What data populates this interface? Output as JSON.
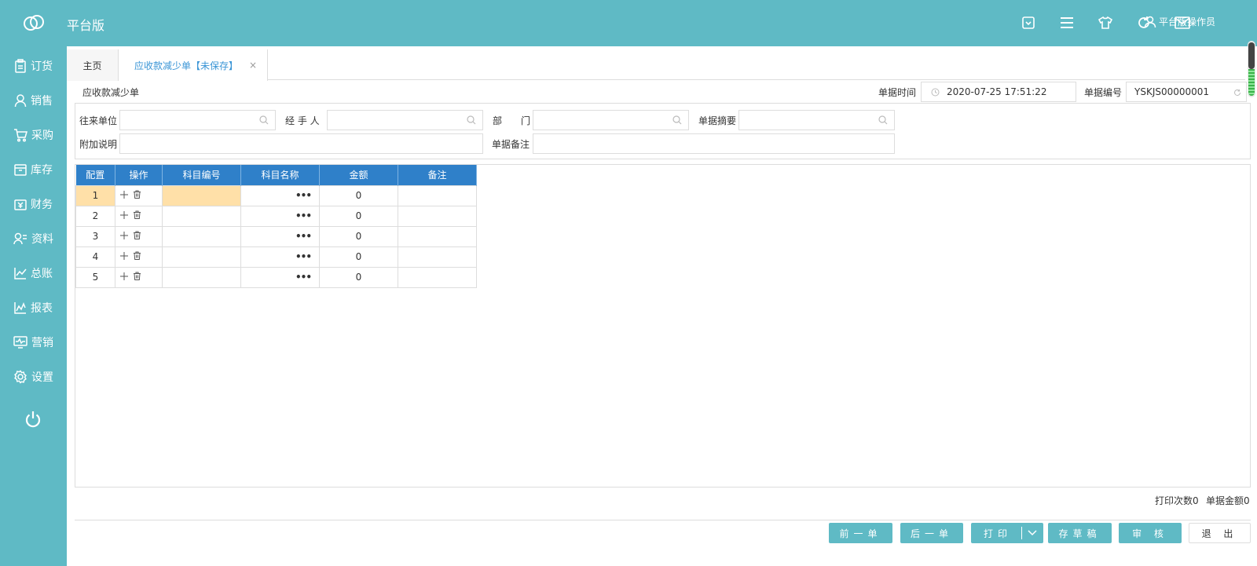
{
  "app": {
    "title": "平台版",
    "user": "平台版操作员"
  },
  "top_icons": [
    "inbox-icon",
    "menu-icon",
    "shirt-icon",
    "refresh-icon",
    "mail-icon"
  ],
  "sidebar": {
    "items": [
      {
        "label": "订货",
        "icon": "clipboard-icon"
      },
      {
        "label": "销售",
        "icon": "user-icon"
      },
      {
        "label": "采购",
        "icon": "cart-icon"
      },
      {
        "label": "库存",
        "icon": "box-icon"
      },
      {
        "label": "财务",
        "icon": "money-icon"
      },
      {
        "label": "资料",
        "icon": "contacts-icon"
      },
      {
        "label": "总账",
        "icon": "chart-icon"
      },
      {
        "label": "报表",
        "icon": "report-icon"
      },
      {
        "label": "营销",
        "icon": "monitor-icon"
      },
      {
        "label": "设置",
        "icon": "gear-icon"
      }
    ]
  },
  "tabs": {
    "home": "主页",
    "active": "应收款减少单【未保存】",
    "close": "×"
  },
  "doc": {
    "title": "应收款减少单",
    "date_label": "单据时间",
    "date_value": "2020-07-25 17:51:22",
    "no_label": "单据编号",
    "no_value": "YSKJS00000001"
  },
  "form": {
    "partner_label": "往来单位",
    "handler_label": "经 手 人",
    "dept_label": "部　　门",
    "summary_label": "单据摘要",
    "note_label": "附加说明",
    "remark_label": "单据备注"
  },
  "grid": {
    "headers": [
      "配置",
      "操作",
      "科目编号",
      "科目名称",
      "金额",
      "备注"
    ],
    "rows": [
      {
        "no": "1",
        "code": "",
        "name": "•••",
        "amount": "0",
        "remark": ""
      },
      {
        "no": "2",
        "code": "",
        "name": "•••",
        "amount": "0",
        "remark": ""
      },
      {
        "no": "3",
        "code": "",
        "name": "•••",
        "amount": "0",
        "remark": ""
      },
      {
        "no": "4",
        "code": "",
        "name": "•••",
        "amount": "0",
        "remark": ""
      },
      {
        "no": "5",
        "code": "",
        "name": "•••",
        "amount": "0",
        "remark": ""
      }
    ],
    "add_glyph": "+"
  },
  "footer": {
    "print_count": "打印次数0",
    "amount": "单据金额0"
  },
  "buttons": {
    "prev": "前一单",
    "next": "后一单",
    "print": "打印",
    "draft": "存草稿",
    "audit": "审 核",
    "exit": "退 出"
  },
  "colors": {
    "primary": "#5fbac5",
    "header_blue": "#2f80c9",
    "selected": "#ffe0a8"
  }
}
